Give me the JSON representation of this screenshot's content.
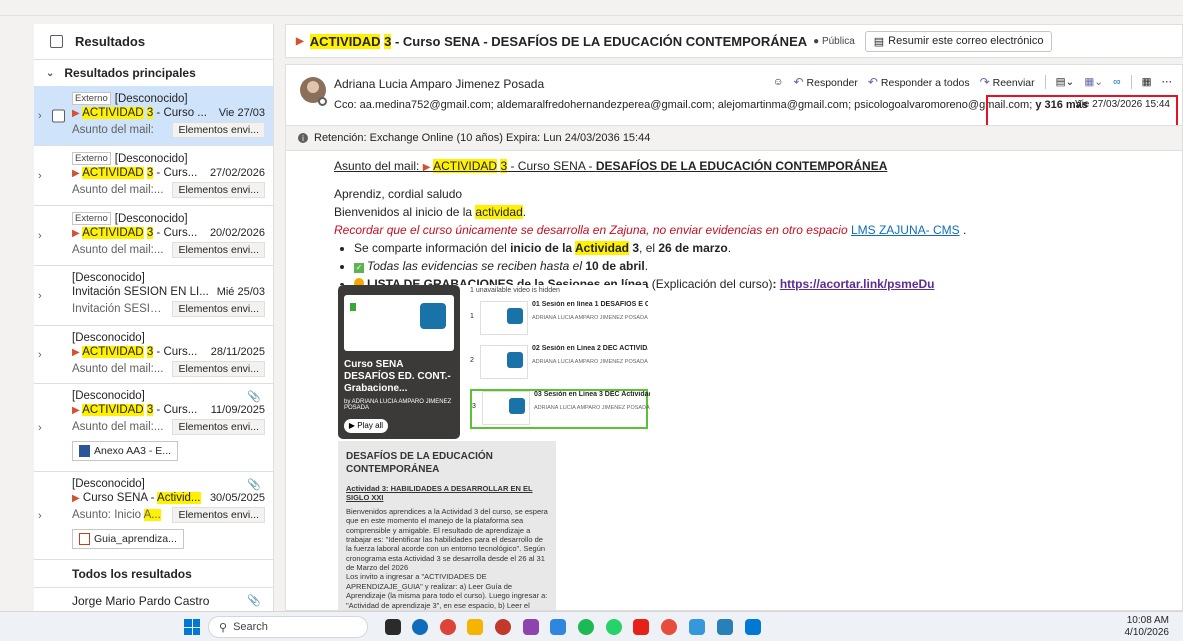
{
  "left": {
    "header": "Resultados",
    "section_main": "Resultados principales",
    "section_all": "Todos los resultados",
    "mails": [
      {
        "tag": "Externo",
        "from": "[Desconocido]",
        "subj_hl": "ACTIVIDAD",
        "subj_num": "3",
        "subj_rest": " - Curso ...",
        "date": "Vie 27/03",
        "preview": "Asunto del mail:",
        "pill": "Elementos envi..."
      },
      {
        "tag": "Externo",
        "from": "[Desconocido]",
        "subj_hl": "ACTIVIDAD",
        "subj_num": "3",
        "subj_rest": " - Curs...",
        "date": "27/02/2026",
        "preview": "Asunto del mail:...",
        "pill": "Elementos envi..."
      },
      {
        "tag": "Externo",
        "from": "[Desconocido]",
        "subj_hl": "ACTIVIDAD",
        "subj_num": "3",
        "subj_rest": " - Curs...",
        "date": "20/02/2026",
        "preview": "Asunto del mail:...",
        "pill": "Elementos envi..."
      },
      {
        "from": "[Desconocido]",
        "subj": "Invitación SESIÓN EN LÍ...",
        "date": "Mié 25/03",
        "preview": "Invitación SESIÓ...",
        "pill": "Elementos envi..."
      },
      {
        "from": "[Desconocido]",
        "subj_hl": "ACTIVIDAD",
        "subj_num": "3",
        "subj_rest": " - Curs...",
        "date": "28/11/2025",
        "preview": "Asunto del mail:...",
        "pill": "Elementos envi..."
      },
      {
        "from": "[Desconocido]",
        "subj_hl": "ACTIVIDAD",
        "subj_num": "3",
        "subj_rest": " - Curs...",
        "date": "11/09/2025",
        "preview": "Asunto del mail:...",
        "pill": "Elementos envi...",
        "attachment": "Anexo AA3 - E..."
      },
      {
        "from": "[Desconocido]",
        "subj_pre": "Curso SENA - ",
        "subj_hl": "Activid...",
        "date": "30/05/2025",
        "preview_pre": "Asunto: Inicio ",
        "preview_hl": "A...",
        "pill": "Elementos envi...",
        "attachment": "Guia_aprendiza..."
      }
    ],
    "last_from": "Jorge Mario Pardo Castro"
  },
  "subject": {
    "hl": "ACTIVIDAD",
    "num": "3",
    "rest": " - Curso SENA - DESAFÍOS DE LA EDUCACIÓN CONTEMPORÁNEA",
    "public": "Pública",
    "summarize": "Resumir este correo electrónico"
  },
  "message": {
    "sender": "Adriana Lucia Amparo Jimenez Posada",
    "cc": "Cco: aa.medina752@gmail.com;  aldemaralfredohernandezperea@gmail.com;  alejomartinma@gmail.com;  psicologoalvaromoreno@gmail.com;",
    "more": "y 316 más",
    "date": "Vie 27/03/2026 15:44",
    "actions": {
      "reply": "Responder",
      "reply_all": "Responder a todos",
      "forward": "Reenviar"
    },
    "retention": "Retención: Exchange Online (10 años) Expira: Lun 24/03/2036 15:44"
  },
  "body": {
    "subj_label": "Asunto del mail",
    "subj_hl": "ACTIVIDAD",
    "subj_num": "3",
    "subj_mid": " - Curso SENA - ",
    "subj_bold": "DESAFÍOS DE LA EDUCACIÓN CONTEMPORÁNEA",
    "greeting": "Aprendiz, cordial saludo",
    "welcome_pre": "Bienvenidos al inicio de la ",
    "welcome_hl": "actividad",
    "welcome_post": ".",
    "reminder": "Recordar que el curso únicamente se desarrolla en Zajuna, no enviar evidencias en otro espacio ",
    "lms_link": "LMS ZAJUNA- CMS",
    "b1_pre": "Se comparte información del ",
    "b1_bold": "inicio de la ",
    "b1_hl": "Actividad",
    "b1_num": "3",
    "b1_mid": ", el ",
    "b1_date": "26 de marzo",
    "b1_end": ".",
    "b2_pre": "Todas las evidencias se reciben hasta el ",
    "b2_bold": "10 de abril",
    "b2_end": ".",
    "b3_bold": "LISTA DE GRABACIONES de la Sesiones en línea",
    "b3_mid": " (Explicación del curso)",
    "b3_colon": ": ",
    "b3_link": "https://acortar.link/psmeDu"
  },
  "playlist": {
    "hidden": "1 unavailable video is hidden",
    "title": "Curso SENA DESAFÍOS ED. CONT.- Grabacione...",
    "author": "by ADRIANA LUCIA AMPARO JIMENEZ POSADA",
    "play": "Play all",
    "videos": [
      {
        "n": "1",
        "title": "01 Sesión en línea 1 DESAFIOS E C BIENVENI",
        "sub": "ADRIANA LUCIA AMPARO JIMENEZ POSADA · 82 views · 2 w"
      },
      {
        "n": "2",
        "title": "02 Sesión en Línea 2 DEC ACTIVIDAD 2 20 03",
        "sub": "ADRIANA LUCIA AMPARO JIMENEZ POSADA · 7 views · 1 d"
      },
      {
        "n": "3",
        "title": "03 Sesión en Línea 3 DEC Actividad 3 27 03",
        "sub": "ADRIANA LUCIA AMPARO JIMENEZ POSADA · No views · 3 h"
      }
    ]
  },
  "doc": {
    "title": "DESAFÍOS DE LA EDUCACIÓN CONTEMPORÁNEA",
    "sub": "Actividad 3: HABILIDADES A DESARROLLAR EN EL SIGLO XXI",
    "para": "Bienvenidos aprendices a la Actividad 3 del curso, se espera que en este momento el manejo de la plataforma sea comprensible y amigable. El resultado de aprendizaje a trabajar es: \"Identificar las habilidades para el desarrollo de la fuerza laboral acorde con un entorno tecnológico\". Según cronograma esta Actividad 3 se desarrolla desde el 26 al 31 de Marzo del 2026",
    "para2": "Los invito a ingresar a \"ACTIVIDADES DE APRENDIZAJE_GUIA\" y realizar: a) Leer Guía de Aprendizaje (la misma para todo el curso). Luego ingresar a: \"Actividad de aprendizaje 3\", en ese espacio, b) Leer el"
  },
  "taskbar": {
    "search": "Search",
    "time": "10:08 AM",
    "date": "4/10/2026"
  }
}
